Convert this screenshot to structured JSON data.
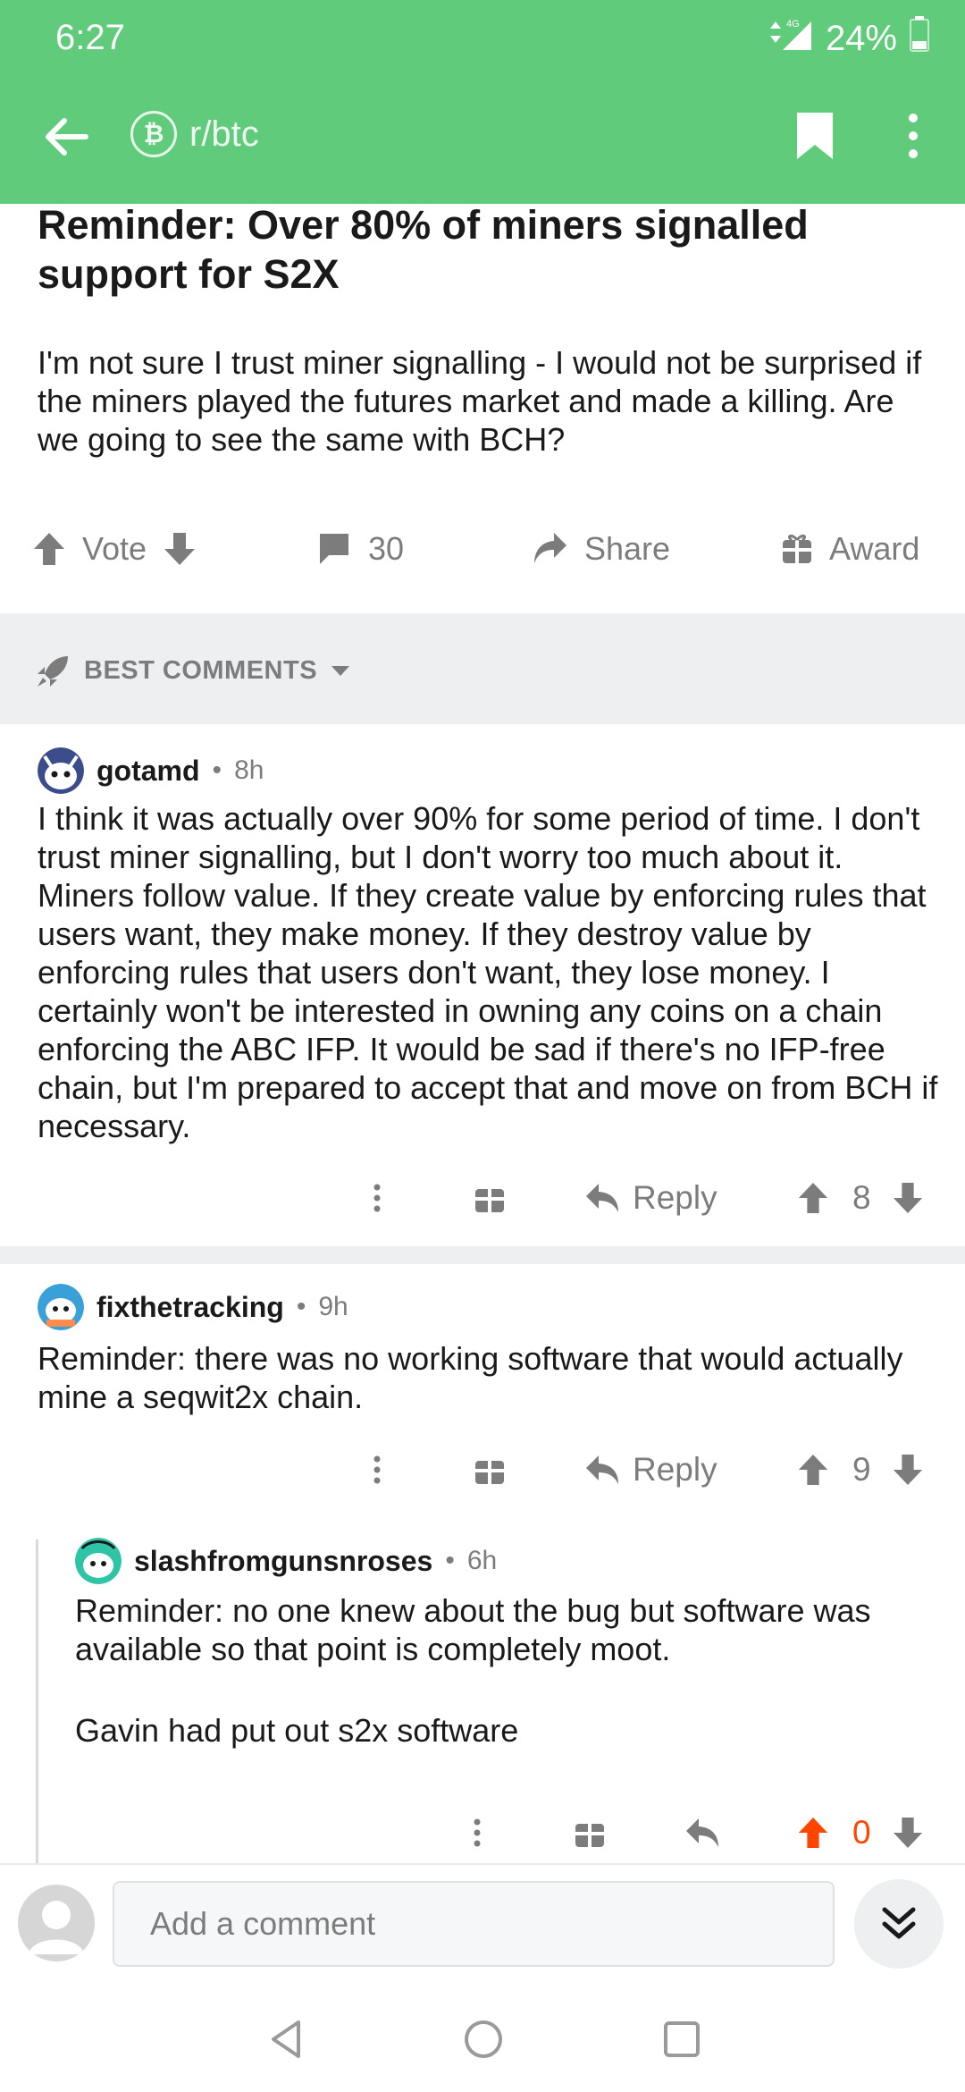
{
  "status": {
    "time": "6:27",
    "network": "4G",
    "battery": "24%"
  },
  "header": {
    "subreddit": "r/btc",
    "sub_icon_glyph": "₿"
  },
  "post": {
    "title": "Reminder: Over 80% of miners signalled support for S2X",
    "body": "I'm not sure I trust miner signalling - I would not be surprised if the miners played the futures market and made a killing. Are we going to see the same with BCH?",
    "vote_label": "Vote",
    "comment_count": "30",
    "share_label": "Share",
    "award_label": "Award"
  },
  "sort": {
    "label": "BEST COMMENTS"
  },
  "comments": [
    {
      "author": "gotamd",
      "time": "8h",
      "body": "I think it was actually over 90% for some period of time. I don't trust miner signalling, but I don't worry too much about it. Miners follow value. If they create value by enforcing rules that users want, they make money. If they destroy value by enforcing rules that users don't want, they lose money. I certainly won't be interested in owning any coins on a chain enforcing the ABC IFP. It would be sad if there's no IFP-free chain, but I'm prepared to accept that and move on from BCH if necessary.",
      "reply_label": "Reply",
      "score": "8"
    },
    {
      "author": "fixthetracking",
      "time": "9h",
      "body": "Reminder: there was no working software that would actually mine a seqwit2x chain.",
      "reply_label": "Reply",
      "score": "9"
    },
    {
      "author": "slashfromgunsnroses",
      "time": "6h",
      "body_p1": "Reminder: no one knew about the bug but software was available so that point is completely moot.",
      "body_p2": "Gavin had put out s2x software",
      "score": "0"
    }
  ],
  "comment_bar": {
    "placeholder": "Add a comment"
  },
  "colors": {
    "header_green": "#5fcb7b",
    "upvote_orange": "#ff4500",
    "meta_gray": "#7c7c7c"
  },
  "icons": [
    "back-arrow-icon",
    "bitcoin-icon",
    "bookmark-icon",
    "more-vert-icon",
    "upvote-icon",
    "downvote-icon",
    "comment-icon",
    "share-icon",
    "award-icon",
    "rocket-icon",
    "caret-down-icon",
    "reply-icon",
    "chevron-double-down-icon"
  ]
}
